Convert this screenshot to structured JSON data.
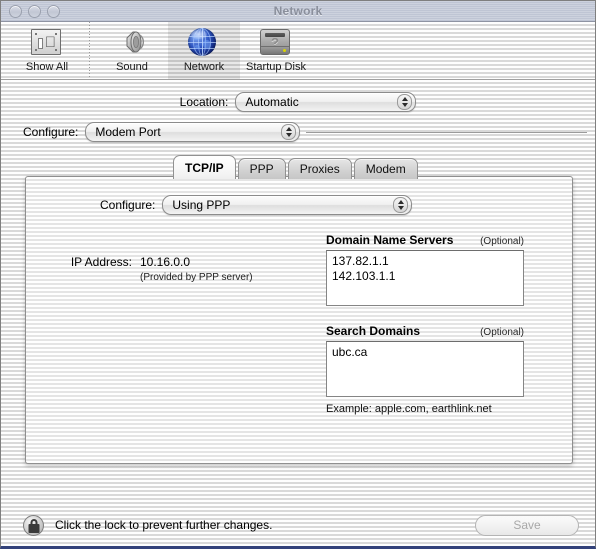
{
  "window": {
    "title": "Network",
    "controls": [
      {
        "name": "close-button"
      },
      {
        "name": "minimize-button"
      },
      {
        "name": "zoom-button"
      }
    ]
  },
  "toolbar": {
    "items": [
      {
        "label": "Show All",
        "icon": "show-all-icon",
        "selected": false
      },
      {
        "label": "Sound",
        "icon": "speaker-icon",
        "selected": false
      },
      {
        "label": "Network",
        "icon": "globe-icon",
        "selected": true
      },
      {
        "label": "Startup Disk",
        "icon": "hard-disk-icon",
        "selected": false
      }
    ]
  },
  "location": {
    "label": "Location:",
    "value": "Automatic"
  },
  "configure_port": {
    "label": "Configure:",
    "value": "Modem Port"
  },
  "tabs": [
    {
      "label": "TCP/IP",
      "active": true
    },
    {
      "label": "PPP",
      "active": false
    },
    {
      "label": "Proxies",
      "active": false
    },
    {
      "label": "Modem",
      "active": false
    }
  ],
  "tcpip": {
    "configure": {
      "label": "Configure:",
      "value": "Using PPP"
    },
    "ip_address": {
      "label": "IP Address:",
      "value": "10.16.0.0",
      "note": "(Provided by PPP server)"
    },
    "dns": {
      "title": "Domain Name Servers",
      "optional": "(Optional)",
      "value": "137.82.1.1\n142.103.1.1"
    },
    "search_domains": {
      "title": "Search Domains",
      "optional": "(Optional)",
      "value": "ubc.ca",
      "example": "Example: apple.com, earthlink.net"
    }
  },
  "bottom": {
    "lock_icon": "locked-padlock-icon",
    "lock_text": "Click the lock to prevent further changes.",
    "save_label": "Save"
  }
}
